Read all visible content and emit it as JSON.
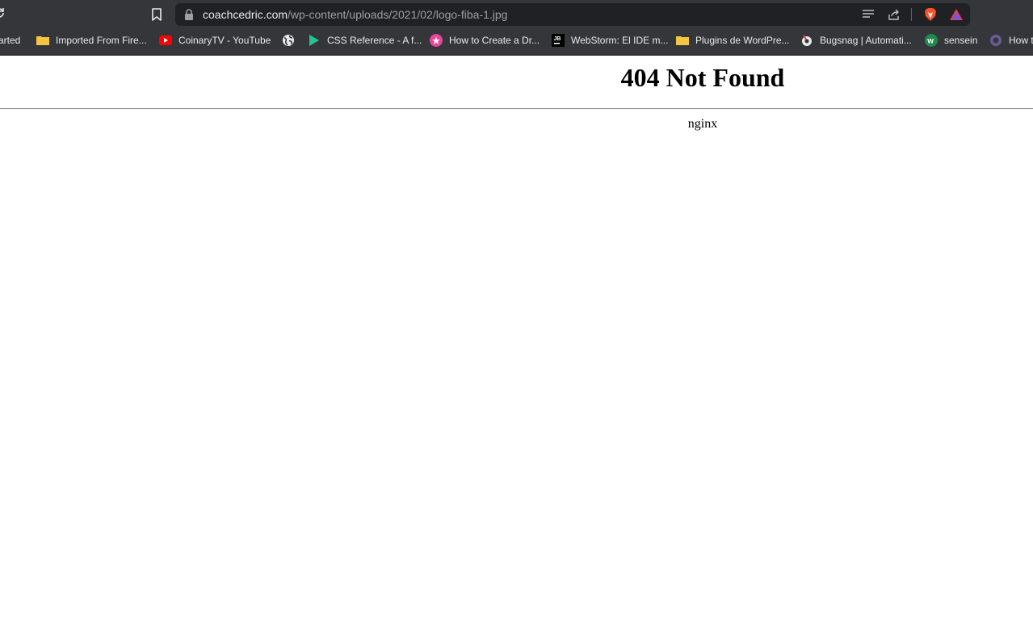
{
  "browser": {
    "url_host": "coachcedric.com",
    "url_path": "/wp-content/uploads/2021/02/logo-fiba-1.jpg",
    "bookmarks": [
      {
        "label": "arted",
        "icon": "partial-bookmark"
      },
      {
        "label": "Imported From Fire...",
        "icon": "folder-icon"
      },
      {
        "label": "CoinaryTV - YouTube",
        "icon": "youtube-icon"
      },
      {
        "label": "",
        "icon": "globe-icon"
      },
      {
        "label": "CSS Reference - A f...",
        "icon": "css-reference-icon"
      },
      {
        "label": "How to Create a Dr...",
        "icon": "pink-star-icon"
      },
      {
        "label": "WebStorm: El IDE m...",
        "icon": "jetbrains-icon"
      },
      {
        "label": "Plugins de WordPre...",
        "icon": "folder-icon"
      },
      {
        "label": "Bugsnag | Automati...",
        "icon": "bugsnag-icon"
      },
      {
        "label": "sensein",
        "icon": "sensein-icon"
      },
      {
        "label": "How t",
        "icon": "generic-site-icon"
      }
    ]
  },
  "page": {
    "heading": "404 Not Found",
    "server": "nginx"
  },
  "colors": {
    "chrome_bg": "#35363a",
    "omnibox_bg": "#202124",
    "url_host": "#e8eaed",
    "url_path": "#9aa0a6"
  }
}
